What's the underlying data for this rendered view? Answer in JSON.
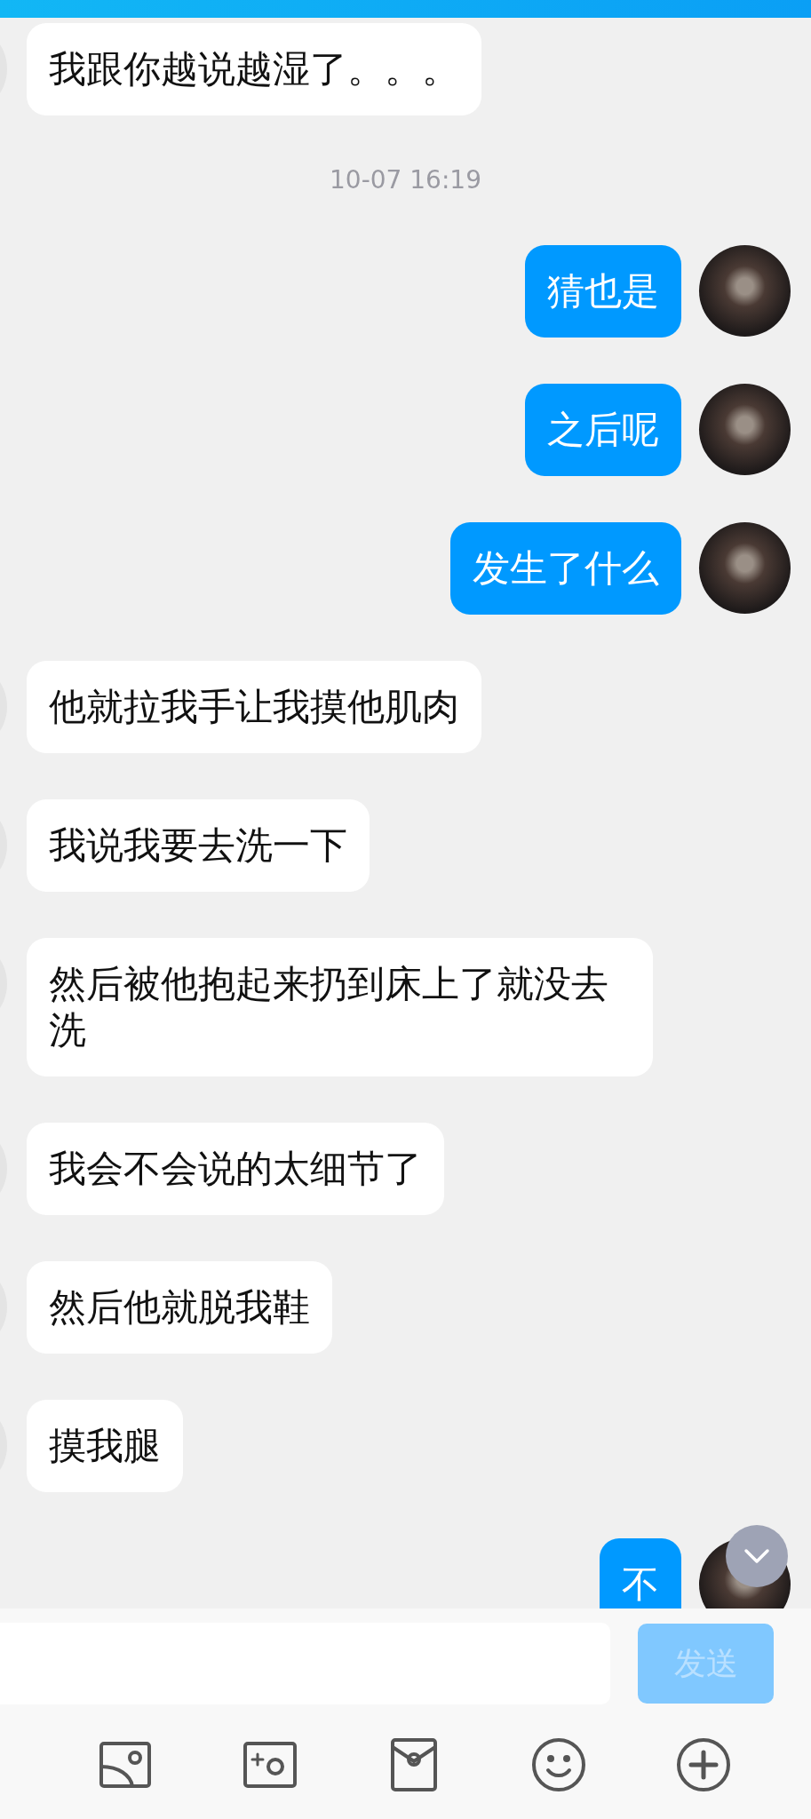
{
  "messages": [
    {
      "kind": "received",
      "text": "我跟你越说越湿了。。。"
    },
    {
      "kind": "time",
      "text": "10-07 16:19"
    },
    {
      "kind": "sent",
      "text": "猜也是"
    },
    {
      "kind": "sent",
      "text": "之后呢"
    },
    {
      "kind": "sent",
      "text": "发生了什么"
    },
    {
      "kind": "received",
      "text": "他就拉我手让我摸他肌肉"
    },
    {
      "kind": "received",
      "text": "我说我要去洗一下"
    },
    {
      "kind": "received",
      "text": "然后被他抱起来扔到床上了就没去洗"
    },
    {
      "kind": "received",
      "text": "我会不会说的太细节了"
    },
    {
      "kind": "received",
      "text": "然后他就脱我鞋"
    },
    {
      "kind": "received",
      "text": "摸我腿"
    },
    {
      "kind": "sent",
      "text": "不"
    }
  ],
  "composer": {
    "send_button": {
      "label": "发送",
      "disabled": true
    }
  }
}
